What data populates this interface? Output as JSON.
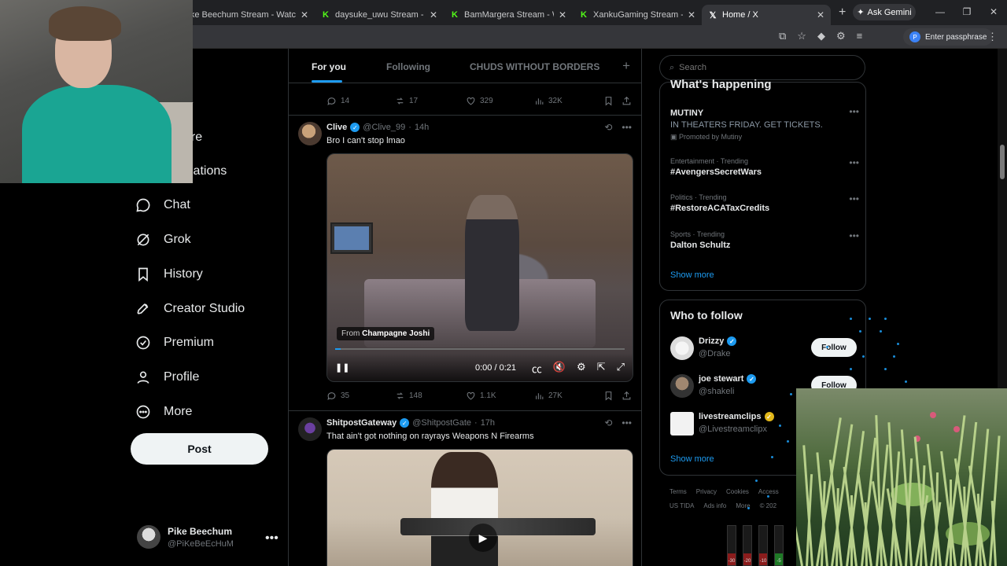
{
  "browser": {
    "tabs": [
      {
        "title": "Pike Beechum Stream - Watc",
        "icon": "kick-icon",
        "active": false
      },
      {
        "title": "daysuke_uwu Stream - Watc",
        "icon": "kick-icon",
        "active": false
      },
      {
        "title": "BamMargera Stream - Watc",
        "icon": "kick-icon",
        "active": false
      },
      {
        "title": "XankuGaming Stream - Watc",
        "icon": "kick-icon",
        "active": false
      },
      {
        "title": "Home / X",
        "icon": "x-icon",
        "active": true
      }
    ],
    "gemini_label": "Ask Gemini",
    "passphrase_label": "Enter passphrase"
  },
  "nav": {
    "partial_items": [
      "e",
      "ore",
      "ications"
    ],
    "items": [
      {
        "label": "Chat",
        "icon": "chat-icon"
      },
      {
        "label": "Grok",
        "icon": "grok-icon"
      },
      {
        "label": "History",
        "icon": "bookmark-icon"
      },
      {
        "label": "Creator Studio",
        "icon": "rocket-icon"
      },
      {
        "label": "Premium",
        "icon": "premium-icon"
      },
      {
        "label": "Profile",
        "icon": "person-icon"
      },
      {
        "label": "More",
        "icon": "more-icon"
      }
    ],
    "post_label": "Post",
    "account": {
      "name": "Pike Beechum",
      "handle": "@PiKeBeEcHuM"
    }
  },
  "feed": {
    "tabs": [
      "For you",
      "Following",
      "CHUDS WITHOUT BORDERS"
    ],
    "active_tab": "For you",
    "top_actions": {
      "replies": "14",
      "reposts": "17",
      "likes": "329",
      "views": "32K"
    },
    "tweets": [
      {
        "name": "Clive",
        "handle": "@Clive_99",
        "time": "14h",
        "text": "Bro I can't stop lmao",
        "video": {
          "from_label": "From",
          "from_name": "Champagne Joshi",
          "time": "0:00 / 0:21",
          "progress": 0.02
        },
        "actions": {
          "replies": "35",
          "reposts": "148",
          "likes": "1.1K",
          "views": "27K"
        }
      },
      {
        "name": "ShitpostGateway",
        "handle": "@ShitpostGate",
        "time": "17h",
        "text": "That ain't got nothing on rayrays Weapons N Firearms"
      }
    ]
  },
  "sidebar": {
    "search_placeholder": "Search",
    "happening_title": "What's happening",
    "trends": [
      {
        "meta": "",
        "title": "MUTINY",
        "sub": "IN THEATERS FRIDAY. GET TICKETS.",
        "promo": "Promoted by Mutiny"
      },
      {
        "meta": "Entertainment · Trending",
        "title": "#AvengersSecretWars"
      },
      {
        "meta": "Politics · Trending",
        "title": "#RestoreACATaxCredits"
      },
      {
        "meta": "Sports · Trending",
        "title": "Dalton Schultz"
      }
    ],
    "show_more": "Show more",
    "who_title": "Who to follow",
    "follow_label": "Follow",
    "follows": [
      {
        "name": "Drizzy",
        "handle": "@Drake",
        "badge": "blue"
      },
      {
        "name": "joe stewart",
        "handle": "@shakeli",
        "badge": "blue"
      },
      {
        "name": "livestreamclips",
        "handle": "@Livestreamclipx",
        "badge": "gold"
      }
    ],
    "footer_row1": [
      "Terms",
      "Privacy",
      "Cookies",
      "Access"
    ],
    "footer_row2": [
      "US TIDA",
      "Ads info",
      "More",
      "© 202"
    ]
  },
  "meters": [
    "-30",
    "-20",
    "-10",
    "-5"
  ]
}
